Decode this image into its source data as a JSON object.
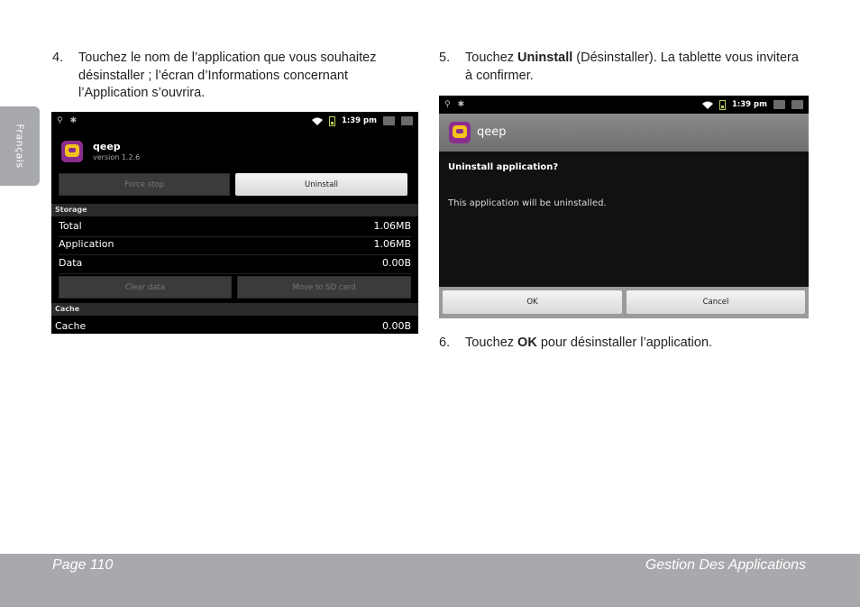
{
  "side_tab": {
    "label": "Français"
  },
  "steps": {
    "s4": {
      "num": "4.",
      "text": "Touchez le nom de l’application que vous souhaitez désinstaller ; l’écran d’Informations concernant l’Application s’ouvrira."
    },
    "s5": {
      "num": "5.",
      "pre": "Touchez ",
      "bold": "Uninstall",
      "post": " (Désinstaller). La tablette vous invitera à confirmer."
    },
    "s6": {
      "num": "6.",
      "pre": "Touchez ",
      "bold": "OK",
      "post": " pour désinstaller l’application."
    }
  },
  "screen1": {
    "status_time": "1:39 pm",
    "app_name": "qeep",
    "app_version": "version 1.2.6",
    "force_stop_label": "Force stop",
    "uninstall_label": "Uninstall",
    "storage_header": "Storage",
    "rows": [
      {
        "label": "Total",
        "value": "1.06MB"
      },
      {
        "label": "Application",
        "value": "1.06MB"
      },
      {
        "label": "Data",
        "value": "0.00B"
      }
    ],
    "clear_data_label": "Clear data",
    "move_sd_label": "Move to SD card",
    "cache_header": "Cache",
    "cache_row": {
      "label": "Cache",
      "value": "0.00B"
    }
  },
  "screen2": {
    "status_time": "1:39 pm",
    "app_name": "qeep",
    "dialog_title": "Uninstall application?",
    "dialog_message": "This application will be uninstalled.",
    "ok_label": "OK",
    "cancel_label": "Cancel"
  },
  "footer": {
    "page": "Page 110",
    "section": "Gestion Des Applications"
  },
  "colors": {
    "footer_bg": "#a7a9ac",
    "side_tab_bg": "#a7a9ac",
    "icon_purple": "#8b2d8f",
    "icon_yellow": "#f4c21b",
    "battery_green": "#b9d35a"
  }
}
